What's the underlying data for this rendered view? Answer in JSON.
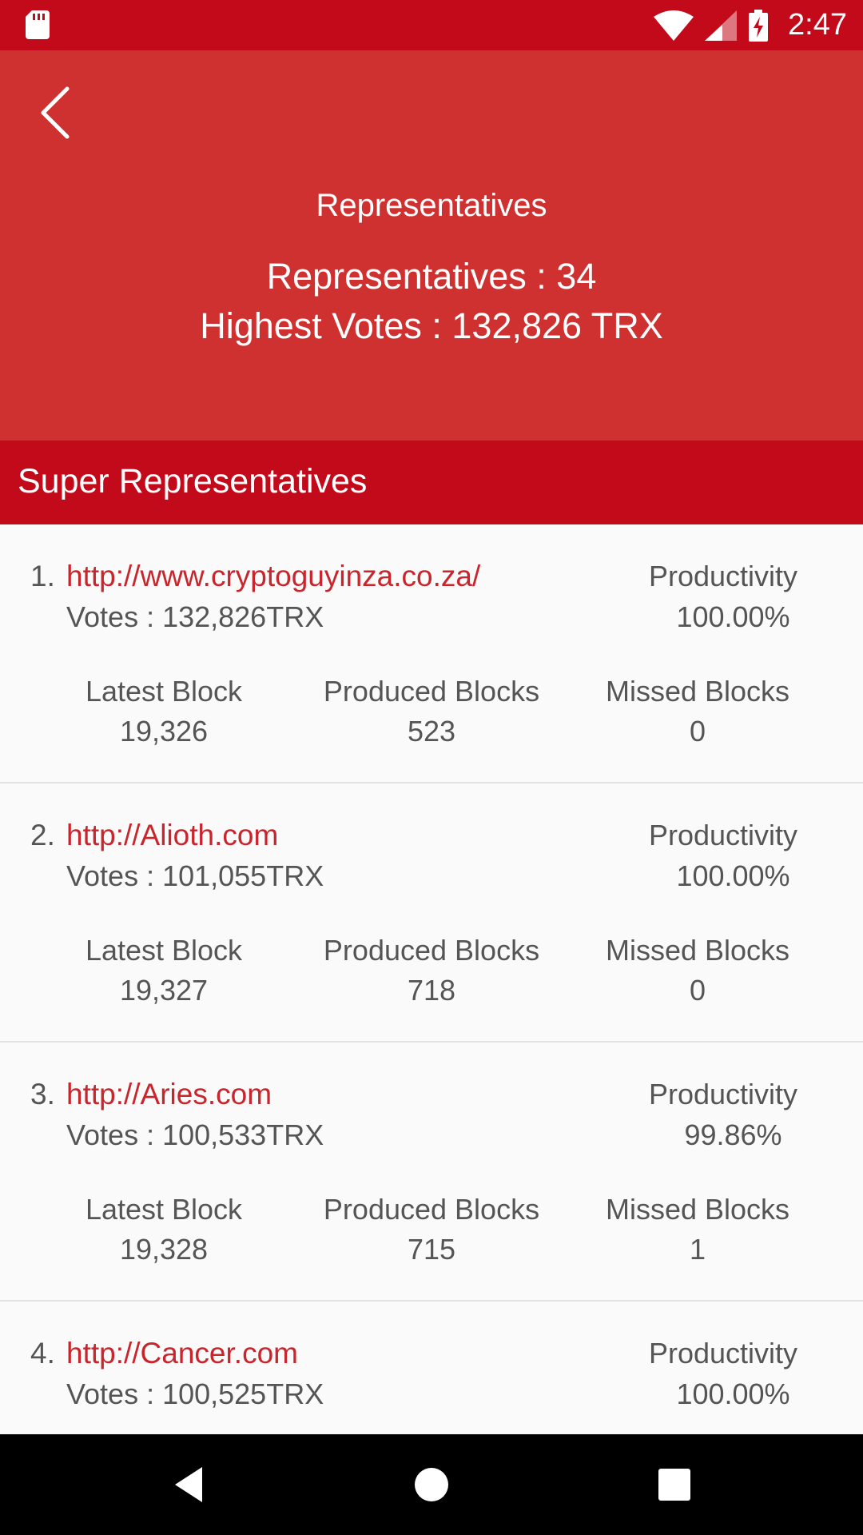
{
  "status": {
    "time": "2:47"
  },
  "header": {
    "title": "Representatives",
    "representatives_line": "Representatives : 34",
    "highest_votes_line": "Highest Votes : 132,826 TRX"
  },
  "section": {
    "title": "Super Representatives"
  },
  "list": {
    "items": [
      {
        "rank": "1.",
        "url": "http://www.cryptoguyinza.co.za/",
        "votes": "Votes : 132,826TRX",
        "productivity_label": "Productivity",
        "productivity": "100.00%",
        "latest_block_label": "Latest Block",
        "latest_block": "19,326",
        "produced_blocks_label": "Produced Blocks",
        "produced_blocks": "523",
        "missed_blocks_label": "Missed Blocks",
        "missed_blocks": "0"
      },
      {
        "rank": "2.",
        "url": "http://Alioth.com",
        "votes": "Votes : 101,055TRX",
        "productivity_label": "Productivity",
        "productivity": "100.00%",
        "latest_block_label": "Latest Block",
        "latest_block": "19,327",
        "produced_blocks_label": "Produced Blocks",
        "produced_blocks": "718",
        "missed_blocks_label": "Missed Blocks",
        "missed_blocks": "0"
      },
      {
        "rank": "3.",
        "url": "http://Aries.com",
        "votes": "Votes : 100,533TRX",
        "productivity_label": "Productivity",
        "productivity": "99.86%",
        "latest_block_label": "Latest Block",
        "latest_block": "19,328",
        "produced_blocks_label": "Produced Blocks",
        "produced_blocks": "715",
        "missed_blocks_label": "Missed Blocks",
        "missed_blocks": "1"
      },
      {
        "rank": "4.",
        "url": "http://Cancer.com",
        "votes": "Votes : 100,525TRX",
        "productivity_label": "Productivity",
        "productivity": "100.00%"
      }
    ]
  },
  "colors": {
    "status_bar": "#c20a1a",
    "app_bar": "#cf3130",
    "section_header": "#c20a1a",
    "link": "#c9252c",
    "text": "#555555"
  }
}
